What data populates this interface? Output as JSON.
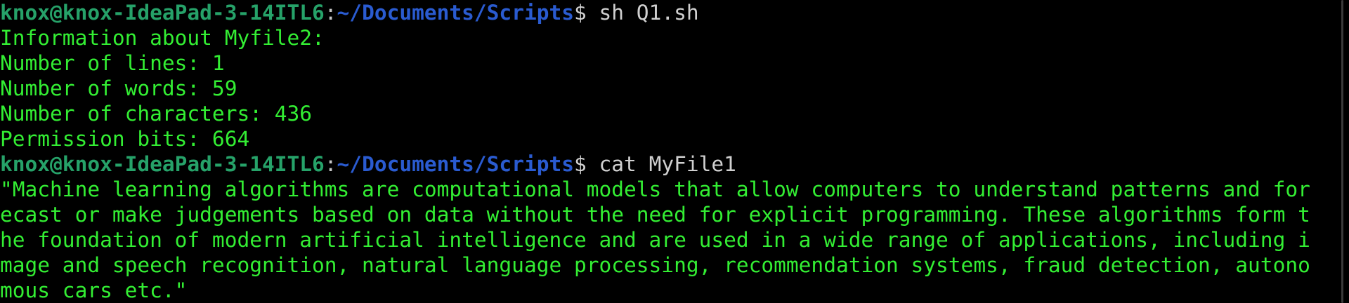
{
  "terminal": {
    "prompt_user_host": "knox@knox-IdeaPad-3-14ITL6",
    "prompt_colon": ":",
    "prompt_path": "~/Documents/Scripts",
    "prompt_dollar": "$",
    "command1": " sh Q1.sh",
    "output1": [
      "Information about Myfile2:",
      "Number of lines: 1",
      "Number of words: 59",
      "Number of characters: 436",
      "Permission bits: 664"
    ],
    "command2": " cat MyFile1",
    "output2": [
      "\"Machine learning algorithms are computational models that allow computers to understand patterns and for",
      "ecast or make judgements based on data without the need for explicit programming. These algorithms form t",
      "he foundation of modern artificial intelligence and are used in a wide range of applications, including i",
      "mage and speech recognition, natural language processing, recommendation systems, fraud detection, autono",
      "mous cars etc.\""
    ]
  },
  "colors": {
    "background": "#000000",
    "output_text": "#33ee33",
    "user_host": "#26a269",
    "path": "#2a5bd0"
  }
}
